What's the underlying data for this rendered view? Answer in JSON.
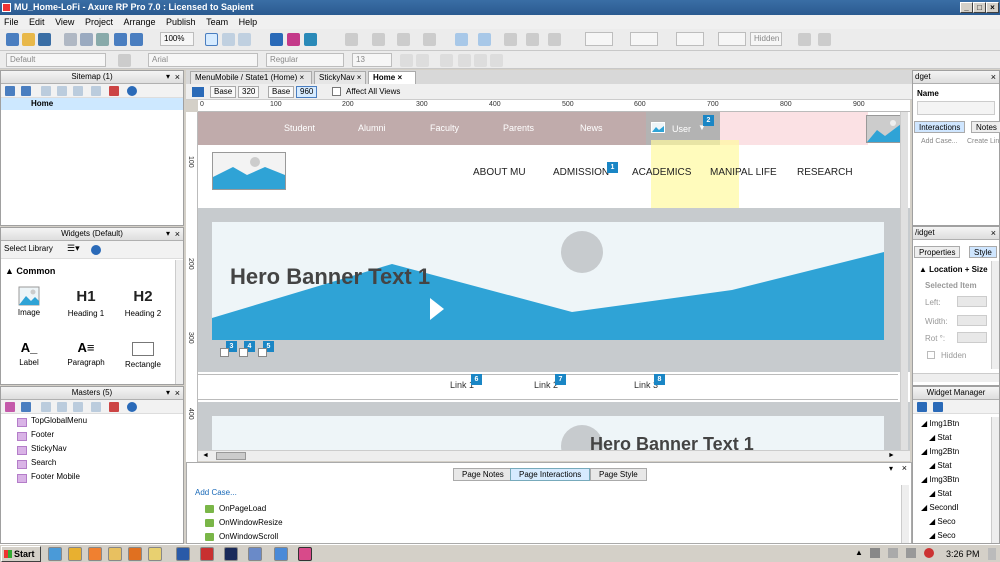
{
  "window": {
    "title": "MU_Home-LoFi - Axure RP Pro 7.0 : Licensed to Sapient"
  },
  "menu": [
    "File",
    "Edit",
    "View",
    "Project",
    "Arrange",
    "Publish",
    "Team",
    "Help"
  ],
  "toolbar": {
    "zoom": "100%",
    "font": "Arial",
    "style": "Regular",
    "size": "13",
    "default_style": "Default",
    "hidden_label": "Hidden"
  },
  "sitemap": {
    "title": "Sitemap (1)",
    "items": [
      "Home"
    ]
  },
  "widgets": {
    "title": "Widgets (Default)",
    "select_library": "Select Library",
    "category": "Common",
    "items": [
      {
        "icon": "image-icon",
        "label": "Image"
      },
      {
        "icon": "h1-icon",
        "glyph": "H1",
        "label": "Heading 1"
      },
      {
        "icon": "h2-icon",
        "glyph": "H2",
        "label": "Heading 2"
      },
      {
        "icon": "label-icon",
        "label": "Label"
      },
      {
        "icon": "paragraph-icon",
        "label": "Paragraph"
      },
      {
        "icon": "rectangle-icon",
        "label": "Rectangle"
      }
    ]
  },
  "masters": {
    "title": "Masters (5)",
    "items": [
      "TopGlobalMenu",
      "Footer",
      "StickyNav",
      "Search",
      "Footer Mobile"
    ]
  },
  "tabs": [
    {
      "label": "MenuMobile / State1 (Home)",
      "active": false
    },
    {
      "label": "StickyNav",
      "active": false
    },
    {
      "label": "Home",
      "active": true
    }
  ],
  "adaptive": {
    "base_label": "Base",
    "base_320": "320",
    "base_960": "960",
    "affect_all": "Affect All Views"
  },
  "ruler": {
    "h": [
      "0",
      "100",
      "200",
      "300",
      "400",
      "500",
      "600",
      "700",
      "800",
      "900"
    ],
    "v": [
      "100",
      "200",
      "300",
      "400"
    ]
  },
  "design": {
    "top_nav": [
      "Student",
      "Alumni",
      "Faculty",
      "Parents",
      "News"
    ],
    "user_label": "User",
    "main_nav": [
      "ABOUT MU",
      "ADMISSION",
      "ACADEMICS",
      "MANIPAL LIFE",
      "RESEARCH"
    ],
    "hero_text": "Hero Banner Text 1",
    "links": [
      "Link 1",
      "Link 2",
      "Link 3"
    ],
    "markers": [
      "1",
      "2",
      "3",
      "4",
      "5",
      "6",
      "7",
      "8"
    ]
  },
  "bottom_panel": {
    "tabs": [
      {
        "label": "Page Notes",
        "active": false
      },
      {
        "label": "Page Interactions",
        "active": true
      },
      {
        "label": "Page Style",
        "active": false
      }
    ],
    "add_case": "Add Case...",
    "events": [
      "OnPageLoad",
      "OnWindowResize",
      "OnWindowScroll"
    ]
  },
  "right1": {
    "title": "dget",
    "name_label": "Name",
    "tabs": [
      "Interactions",
      "Notes"
    ],
    "add_case": "Add Case...",
    "create_link": "Create Lin"
  },
  "right2": {
    "title": "/idget",
    "tabs": [
      "Properties",
      "Style"
    ],
    "section": "Location + Size",
    "selected": "Selected Item",
    "fields": [
      "Left:",
      "Width:",
      "Rot °:"
    ],
    "hidden": "Hidden"
  },
  "right3": {
    "title": "Widget Manager",
    "items": [
      "Img1Btn",
      "Stat",
      "Img2Btn",
      "Stat",
      "Img3Btn",
      "Stat",
      "SecondI",
      "Seco",
      "Seco"
    ]
  },
  "taskbar": {
    "start": "Start",
    "clock": "3:26 PM"
  },
  "colors": {
    "accent": "#1a86c5",
    "hero_blue": "#2fa3d6",
    "title_blue": "#3a6ea5"
  }
}
